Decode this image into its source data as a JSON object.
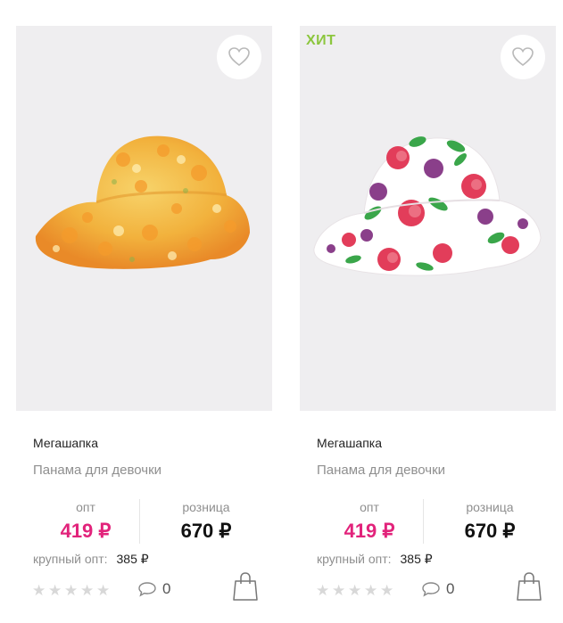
{
  "products": [
    {
      "badge": "",
      "brand": "Мегашапка",
      "title": "Панама для девочки",
      "opt_label": "опт",
      "opt_price": "419 ₽",
      "retail_label": "розница",
      "retail_price": "670 ₽",
      "bulk_label": "крупный опт:",
      "bulk_price": "385 ₽",
      "rating": 0,
      "comments": "0",
      "image": "floral-yellow-orange-hat"
    },
    {
      "badge": "ХИТ",
      "brand": "Мегашапка",
      "title": "Панама для девочки",
      "opt_label": "опт",
      "opt_price": "419 ₽",
      "retail_label": "розница",
      "retail_price": "670 ₽",
      "bulk_label": "крупный опт:",
      "bulk_price": "385 ₽",
      "rating": 0,
      "comments": "0",
      "image": "white-hat-with-roses"
    }
  ],
  "colors": {
    "opt_price": "#e2237b",
    "badge": "#8cc63e",
    "photo_bg": "#efeef0"
  },
  "icons": [
    "heart-icon",
    "star-icon",
    "comment-icon",
    "shopping-bag-icon"
  ]
}
